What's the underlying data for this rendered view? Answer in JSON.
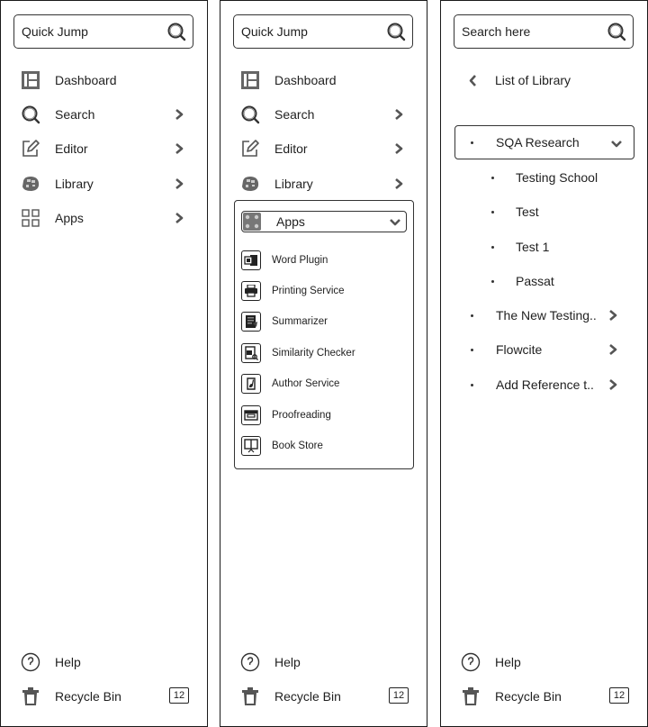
{
  "panels": [
    {
      "search": {
        "placeholder": "Quick Jump",
        "icon": "search-icon"
      },
      "nav": [
        {
          "label": "Dashboard",
          "icon": "dashboard-icon",
          "has_chevron": false
        },
        {
          "label": "Search",
          "icon": "search-icon",
          "has_chevron": true
        },
        {
          "label": "Editor",
          "icon": "edit-icon",
          "has_chevron": true
        },
        {
          "label": "Library",
          "icon": "library-icon",
          "has_chevron": true
        },
        {
          "label": "Apps",
          "icon": "apps-grid-icon",
          "has_chevron": true
        }
      ],
      "help_label": "Help",
      "recycle_label": "Recycle Bin",
      "recycle_count": "12"
    },
    {
      "search": {
        "placeholder": "Quick Jump",
        "icon": "search-icon"
      },
      "nav": [
        {
          "label": "Dashboard",
          "icon": "dashboard-icon",
          "has_chevron": false
        },
        {
          "label": "Search",
          "icon": "search-icon",
          "has_chevron": true
        },
        {
          "label": "Editor",
          "icon": "edit-icon",
          "has_chevron": true
        },
        {
          "label": "Library",
          "icon": "library-icon",
          "has_chevron": true
        }
      ],
      "apps": {
        "label": "Apps",
        "expanded": true,
        "items": [
          {
            "label": "Word Plugin",
            "icon": "word-plugin-icon"
          },
          {
            "label": "Printing Service",
            "icon": "printer-icon"
          },
          {
            "label": "Summarizer",
            "icon": "summarizer-icon"
          },
          {
            "label": "Similarity Checker",
            "icon": "similarity-checker-icon"
          },
          {
            "label": "Author Service",
            "icon": "author-service-icon"
          },
          {
            "label": "Proofreading",
            "icon": "proofreading-icon"
          },
          {
            "label": "Book Store",
            "icon": "book-store-icon"
          }
        ]
      },
      "help_label": "Help",
      "recycle_label": "Recycle Bin",
      "recycle_count": "12"
    },
    {
      "search": {
        "placeholder": "Search here",
        "icon": "search-icon"
      },
      "back_label": "List of Library",
      "tree": [
        {
          "label": "SQA Research",
          "expanded": true,
          "children": [
            "Testing School",
            "Test",
            "Test 1",
            "Passat"
          ]
        },
        {
          "label": "The New Testing..",
          "expanded": false
        },
        {
          "label": "Flowcite",
          "expanded": false
        },
        {
          "label": "Add Reference t..",
          "expanded": false
        }
      ],
      "help_label": "Help",
      "recycle_label": "Recycle Bin",
      "recycle_count": "12"
    }
  ]
}
